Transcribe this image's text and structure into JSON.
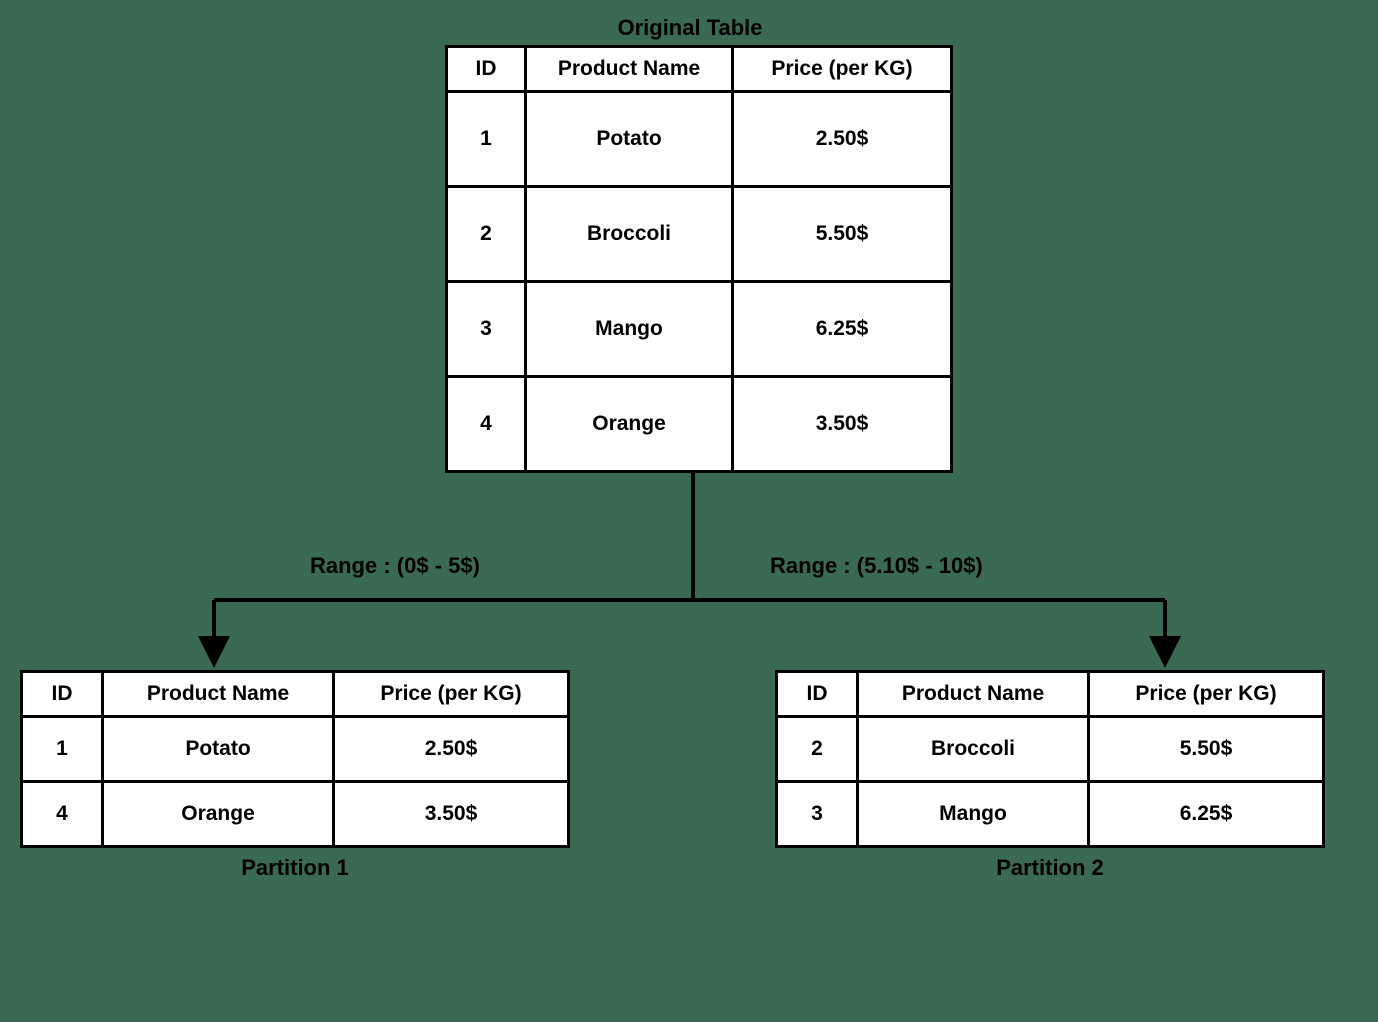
{
  "titles": {
    "original": "Original Table",
    "partition1": "Partition 1",
    "partition2": "Partition 2"
  },
  "headers": {
    "id": "ID",
    "name": "Product Name",
    "price": "Price (per KG)"
  },
  "ranges": {
    "left": "Range : (0$ - 5$)",
    "right": "Range : (5.10$ - 10$)"
  },
  "original": {
    "rows": [
      {
        "id": "1",
        "name": "Potato",
        "price": "2.50$"
      },
      {
        "id": "2",
        "name": "Broccoli",
        "price": "5.50$"
      },
      {
        "id": "3",
        "name": "Mango",
        "price": "6.25$"
      },
      {
        "id": "4",
        "name": "Orange",
        "price": "3.50$"
      }
    ]
  },
  "partition1": {
    "rows": [
      {
        "id": "1",
        "name": "Potato",
        "price": "2.50$"
      },
      {
        "id": "4",
        "name": "Orange",
        "price": "3.50$"
      }
    ]
  },
  "partition2": {
    "rows": [
      {
        "id": "2",
        "name": "Broccoli",
        "price": "5.50$"
      },
      {
        "id": "3",
        "name": "Mango",
        "price": "6.25$"
      }
    ]
  }
}
